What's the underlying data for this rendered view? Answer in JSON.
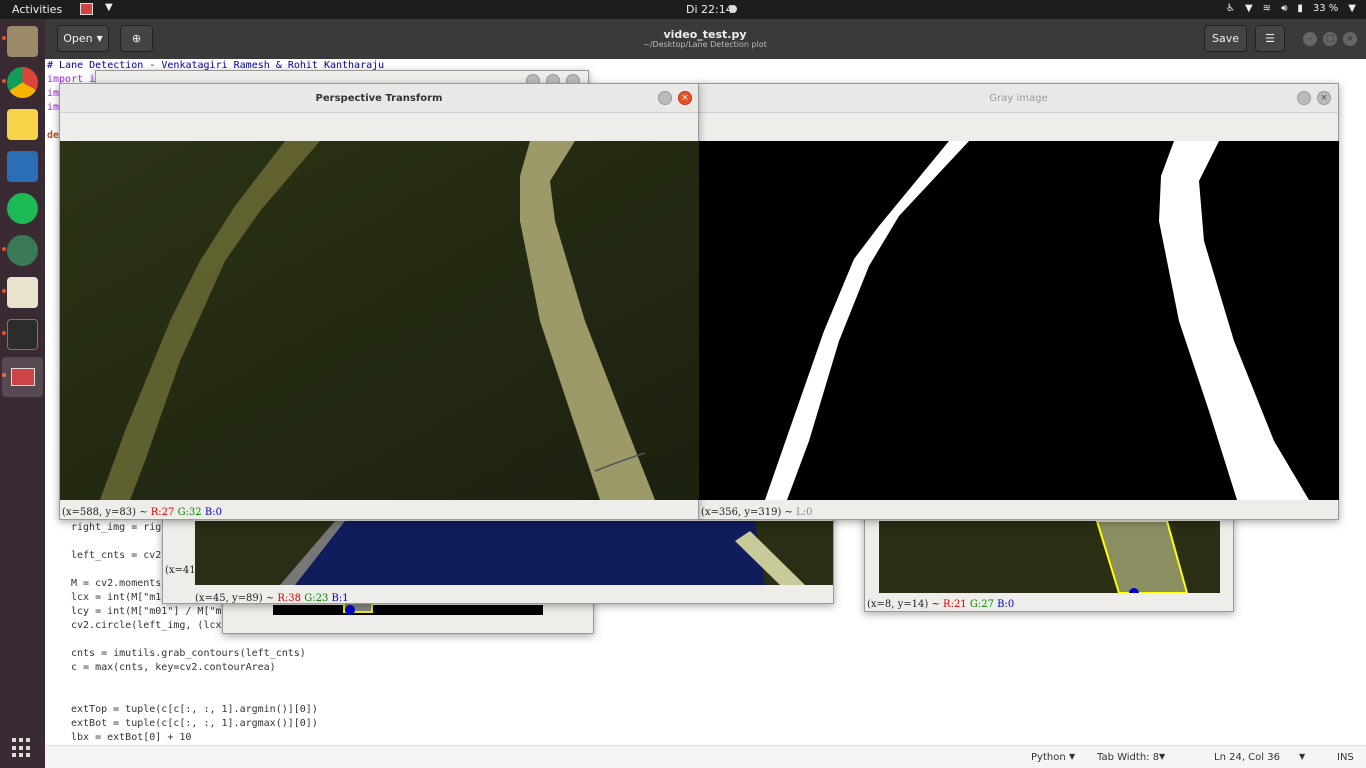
{
  "topbar": {
    "activities": "Activities",
    "clock": "Di 22:14",
    "battery": "33 %"
  },
  "gedit": {
    "open_label": "Open",
    "title": "video_test.py",
    "subtitle": "~/Desktop/Lane Detection plot",
    "save_label": "Save"
  },
  "code": {
    "line1": "# Lane Detection - Venkatagiri Ramesh & Rohit Kantharaju",
    "line2": "import i",
    "line3": "im",
    "line4": "im",
    "line5": "de",
    "right_img": "right_img = rig",
    "left_cnts": "left_cnts = cv2",
    "moments": "M = cv2.moments(left",
    "lcx": "lcx = int(M[\"m10\"] / ",
    "lcy": "lcy = int(M[\"m01\"] / M[\"m",
    "circle": "cv2.circle(left_img, (lcx",
    "grab": "cnts = imutils.grab_contours(left_cnts)",
    "cmax": "c = max(cnts, key=cv2.contourArea)",
    "exttop": "extTop = tuple(c[c[:, :, 1].argmin()][0])",
    "extbot": "extBot = tuple(c[c[:, :, 1].argmax()][0])",
    "lbx": "lbx = extBot[0] + 10"
  },
  "statusbar": {
    "language": "Python",
    "tab_width": "Tab Width: 8",
    "position": "Ln 24, Col 36",
    "mode": "INS"
  },
  "windows": {
    "perspective": {
      "title": "Perspective Transform",
      "coords": "(x=588, y=83) ~",
      "r": "R:27",
      "g": "G:32",
      "b": "B:0"
    },
    "gray": {
      "title": "Gray image",
      "coords": "(x=356, y=319) ~",
      "l": "L:0"
    },
    "back_mid": {
      "coords": "(x=45, y=89) ~",
      "r": "R:38",
      "g": "G:23",
      "b": "B:1"
    },
    "back_mid2": {
      "coords": "(x=41"
    },
    "back_right": {
      "coords": "(x=8, y=14) ~",
      "r": "R:21",
      "g": "G:27",
      "b": "B:0"
    }
  }
}
